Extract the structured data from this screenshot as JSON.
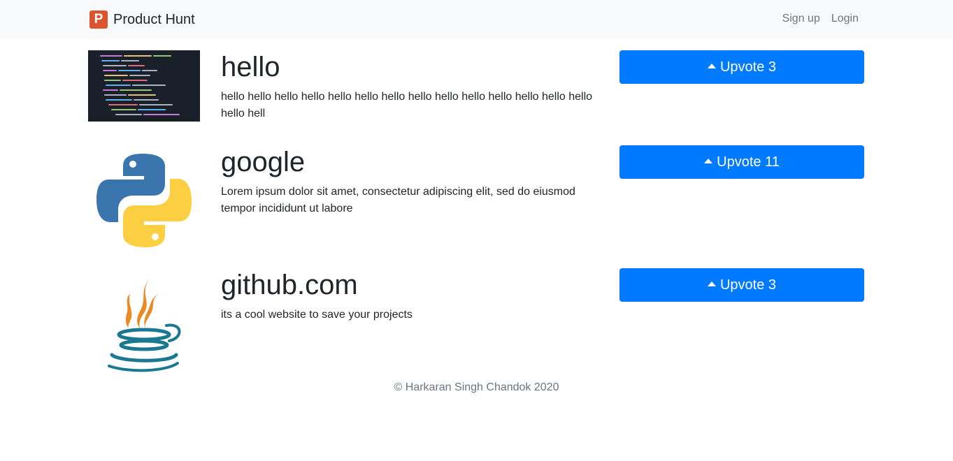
{
  "navbar": {
    "brand_logo_letter": "P",
    "brand_name": "Product Hunt",
    "links": [
      "Sign up",
      "Login"
    ]
  },
  "products": [
    {
      "title": "hello",
      "description": "hello hello hello hello hello hello hello hello hello hello hello hello hello hello hello hell",
      "upvote_label": "Upvote 3",
      "icon": "code-screenshot-image"
    },
    {
      "title": "google",
      "description": "Lorem ipsum dolor sit amet, consectetur adipiscing elit, sed do eiusmod tempor incididunt ut labore",
      "upvote_label": "Upvote 11",
      "icon": "python-logo-image"
    },
    {
      "title": "github.com",
      "description": "its a cool website to save your projects",
      "upvote_label": "Upvote 3",
      "icon": "java-logo-image"
    }
  ],
  "footer": {
    "text": "© Harkaran Singh Chandok 2020"
  },
  "colors": {
    "brand": "#da552f",
    "button": "#007bff",
    "navbar_bg": "#f8f9fa",
    "muted": "#6c757d"
  }
}
